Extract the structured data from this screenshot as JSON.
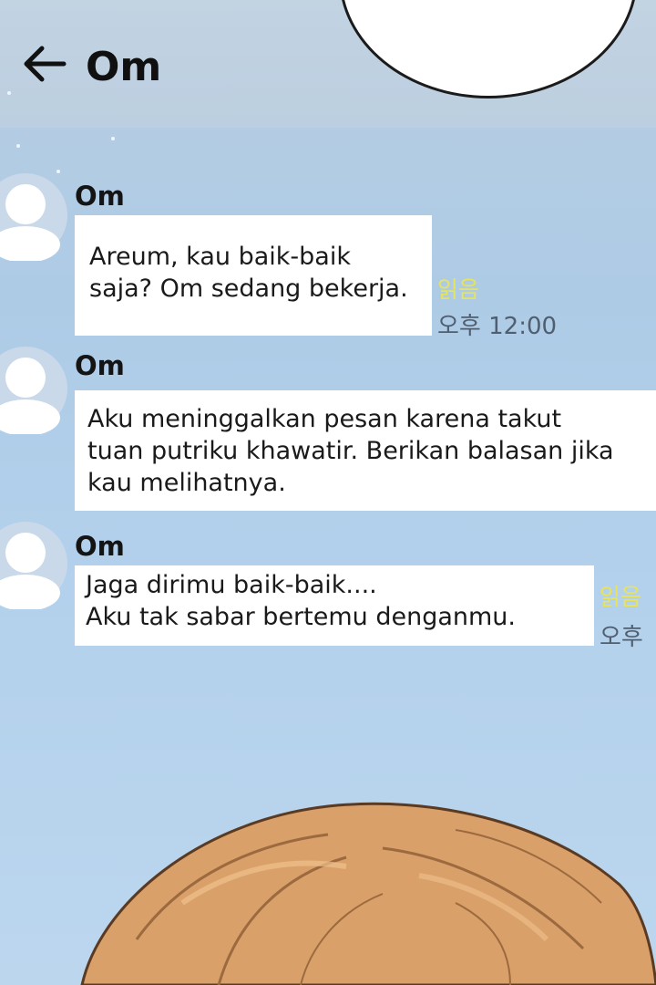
{
  "header": {
    "title": "Om",
    "back_icon": "arrow-left-icon"
  },
  "messages": [
    {
      "sender": "Om",
      "text": "Areum, kau baik-baik\nsaja? Om sedang bekerja.",
      "read": "읽음",
      "time": "오후 12:00"
    },
    {
      "sender": "Om",
      "text": "Aku meninggalkan pesan karena takut\ntuan putriku khawatir. Berikan balasan jika\nkau melihatnya."
    },
    {
      "sender": "Om",
      "text": "Jaga dirimu baik-baik....\nAku tak sabar bertemu denganmu.",
      "read": "읽음",
      "time": "오후"
    }
  ],
  "colors": {
    "background": "#b3d1ec",
    "bubble": "#ffffff",
    "read_receipt": "#e7e35a",
    "avatar": "#c9d9ea",
    "hair": "#d9a06a"
  }
}
